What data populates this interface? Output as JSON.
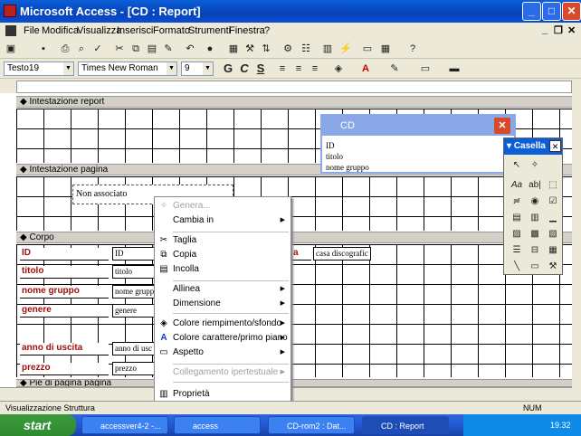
{
  "window": {
    "title": "Microsoft Access - [CD : Report]",
    "minimize": "_",
    "maximize": "□",
    "close": "✕",
    "inner_min": "_",
    "inner_max": "❐",
    "inner_close": "✕"
  },
  "menu": [
    "File",
    "Modifica",
    "Visualizza",
    "Inserisci",
    "Formato",
    "Strumenti",
    "Finestra",
    "?"
  ],
  "formatting": {
    "object_combo": "Testo19",
    "font_combo": "Times New Roman",
    "size_combo": "9",
    "bold": "G",
    "italic": "C",
    "underline": "S"
  },
  "sections": {
    "report_header": "Intestazione report",
    "page_header": "Intestazione pagina",
    "body": "Corpo",
    "page_footer": "Piè di pagina pagina"
  },
  "page_header_control": "Non associato",
  "body_labels": [
    "ID",
    "titolo",
    "nome gruppo",
    "genere",
    "anno di uscita",
    "prezzo"
  ],
  "body_fields": [
    "ID",
    "titolo",
    "nome grupp",
    "genere",
    "anno di usc",
    "prezzo"
  ],
  "extra_label": "a",
  "extra_field": "casa discografic",
  "context_menu": {
    "items": [
      {
        "label": "Genera...",
        "disabled": true,
        "submenu": false,
        "icon": "genera-icon"
      },
      {
        "label": "Cambia in",
        "disabled": false,
        "submenu": true,
        "icon": ""
      },
      {
        "label": "Taglia",
        "disabled": false,
        "submenu": false,
        "icon": "scissors-icon"
      },
      {
        "label": "Copia",
        "disabled": false,
        "submenu": false,
        "icon": "copy-icon"
      },
      {
        "label": "Incolla",
        "disabled": false,
        "submenu": false,
        "icon": "paste-icon"
      },
      {
        "label": "Allinea",
        "disabled": false,
        "submenu": true,
        "icon": ""
      },
      {
        "label": "Dimensione",
        "disabled": false,
        "submenu": true,
        "icon": ""
      },
      {
        "label": "Colore riempimento/sfondo",
        "disabled": false,
        "submenu": true,
        "icon": "fill-color-icon"
      },
      {
        "label": "Colore carattere/primo piano",
        "disabled": false,
        "submenu": true,
        "icon": "font-color-icon"
      },
      {
        "label": "Aspetto",
        "disabled": false,
        "submenu": true,
        "icon": "appearance-icon"
      },
      {
        "label": "Collegamento ipertestuale",
        "disabled": true,
        "submenu": true,
        "icon": ""
      },
      {
        "label": "Proprietà",
        "disabled": false,
        "submenu": false,
        "icon": "properties-icon"
      }
    ]
  },
  "field_list": {
    "title": "CD",
    "fields": [
      "ID",
      "titolo",
      "nome gruppo"
    ]
  },
  "toolbox": {
    "title": "Casella"
  },
  "status": {
    "left": "Visualizzazione Struttura",
    "num": "NUM"
  },
  "taskbar": {
    "start": "start",
    "tasks": [
      "accessver4-2 -...",
      "access",
      "CD-rom2 : Dat...",
      "CD : Report"
    ],
    "clock": "19.32"
  },
  "colors": {
    "title_bar": "#0A5FD8",
    "label_text": "#A01010",
    "start_button": "#3C9A3C"
  }
}
